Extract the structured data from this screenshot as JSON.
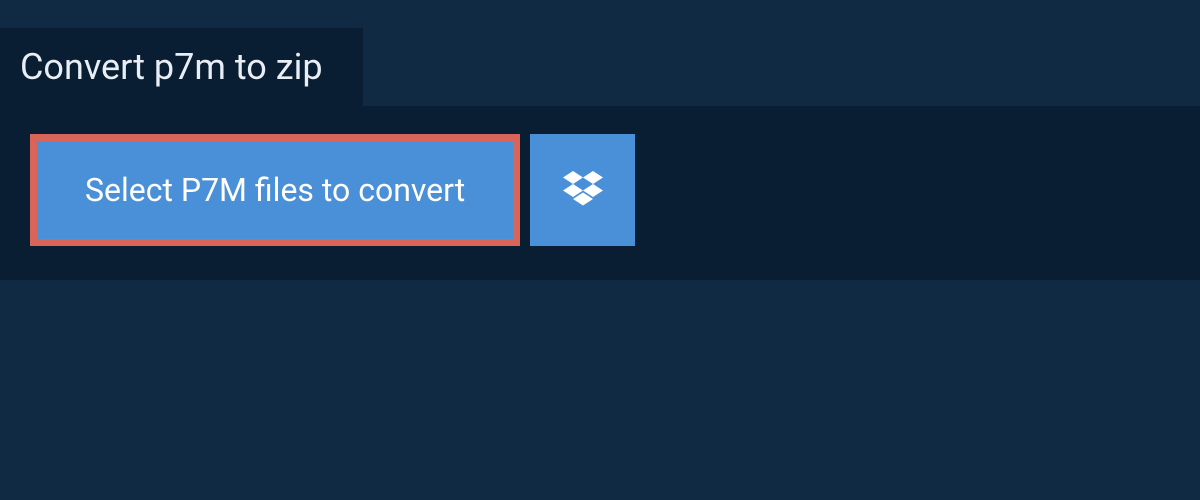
{
  "header": {
    "title": "Convert p7m to zip"
  },
  "actions": {
    "select_files_label": "Select P7M files to convert"
  },
  "colors": {
    "background": "#102a43",
    "panel": "#0a1e33",
    "button": "#4a90d9",
    "button_highlight_border": "#d96459",
    "text_light": "#e8eef5"
  }
}
